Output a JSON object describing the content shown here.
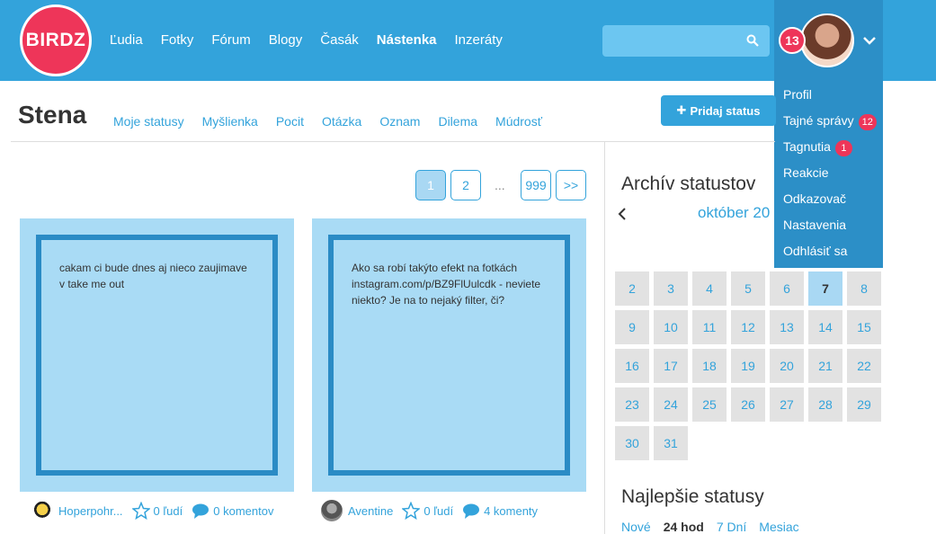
{
  "header": {
    "logo": "BIRDZ",
    "nav": [
      "Ľudia",
      "Fotky",
      "Fórum",
      "Blogy",
      "Časák",
      "Nástenka",
      "Inzeráty"
    ],
    "active_nav": "Nástenka",
    "notif_count": "13"
  },
  "user_menu": [
    {
      "label": "Profil",
      "badge": ""
    },
    {
      "label": "Tajné správy",
      "badge": "12"
    },
    {
      "label": "Tagnutia",
      "badge": "1"
    },
    {
      "label": "Reakcie",
      "badge": ""
    },
    {
      "label": "Odkazovač",
      "badge": ""
    },
    {
      "label": "Nastavenia",
      "badge": ""
    },
    {
      "label": "Odhlásiť sa",
      "badge": ""
    }
  ],
  "page": {
    "title": "Stena",
    "tabs": [
      "Moje statusy",
      "Myšlienka",
      "Pocit",
      "Otázka",
      "Oznam",
      "Dilema",
      "Múdrosť"
    ],
    "add_button": "Pridaj status"
  },
  "pagination": {
    "pages": [
      "1",
      "2"
    ],
    "ellipsis": "...",
    "last": "999",
    "next": ">>",
    "current": "1"
  },
  "statuses": [
    {
      "text": "cakam ci bude dnes aj nieco zaujimave v take me out",
      "author": "Hoperpohr...",
      "likes": "0 ľudí",
      "comments": "0 komentov"
    },
    {
      "text": "Ako sa robí takýto efekt na fotkách instagram.com/p/BZ9FlUulcdk - neviete niekto? Je na to nejaký filter, či?",
      "author": "Aventine",
      "likes": "0 ľudí",
      "comments": "4 komenty"
    }
  ],
  "sidebar": {
    "archive_title": "Archív statustov",
    "month": "október 20",
    "days": [
      "2",
      "3",
      "4",
      "5",
      "6",
      "7",
      "8",
      "9",
      "10",
      "11",
      "12",
      "13",
      "14",
      "15",
      "16",
      "17",
      "18",
      "19",
      "20",
      "21",
      "22",
      "23",
      "24",
      "25",
      "26",
      "27",
      "28",
      "29",
      "30",
      "31"
    ],
    "today": "7",
    "best_title": "Najlepšie statusy",
    "best_tabs": [
      "Nové",
      "24 hod",
      "7 Dní",
      "Mesiac"
    ],
    "best_active": "24 hod"
  },
  "colors": {
    "primary": "#33a3db",
    "accent": "#ee3559",
    "menu": "#2c8fc7",
    "card": "#a9dbf5",
    "card_border": "#2a8bc5"
  }
}
